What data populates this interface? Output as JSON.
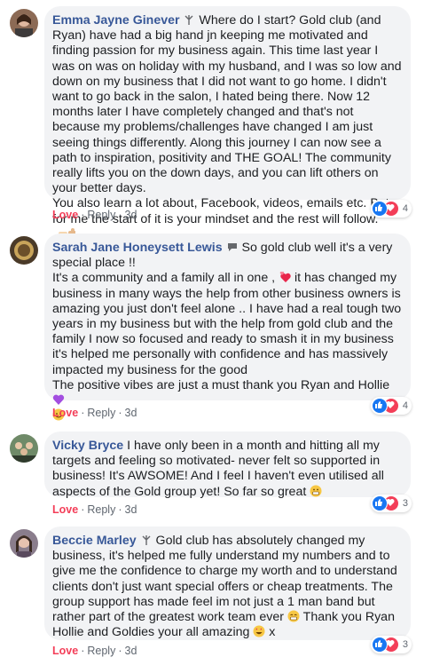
{
  "colors": {
    "name": "#385898",
    "love": "#f33e58",
    "bubble_bg": "#f2f3f5",
    "meta": "#606770",
    "like_blue": "#1877f2"
  },
  "comments": [
    {
      "author": "Emma Jayne Ginever",
      "badge_icon": "rising-star-icon",
      "text": " Where do I start? Gold club (and Ryan) have had a big hand jn keeping me motivated and finding passion for my business again. This time last year I was on was on holiday with my husband, and I was so low and down on my business that I did not want to go home. I didn't want to go back in the salon, I hated being there. Now 12 months later I have completely changed and that's not because my problems/challenges have changed I am just seeing things differently. Along this journey I can now see a path to inspiration, positivity and THE GOAL! The community really lifts you on the down days, and you can lift others on your better days.\nYou also learn a lot about, Facebook, videos, emails etc. But for me the start of it is your mindset and the rest will follow.",
      "trailing_emoji": "thumbs-up-emoji",
      "love_label": "Love",
      "reply_label": "Reply",
      "time": "3d",
      "reaction_count": "4"
    },
    {
      "author": "Sarah Jane Honeysett Lewis",
      "badge_icon": "conversation-starter-icon",
      "text": " So gold club well it's a very special place !!\nIt's a community and a family all in one ,",
      "text2": " it has changed my business in many ways the help from other business owners is amazing you just don't feel alone .. I have had a real tough two years in my business but with the help from gold club and the family I now so focused and ready to smash it in my business it's helped me personally with confidence and has massively impacted my business for the good\nThe positive vibes are just a must thank you Ryan and Hollie",
      "love_label": "Love",
      "reply_label": "Reply",
      "time": "3d",
      "reaction_count": "4"
    },
    {
      "author": "Vicky Bryce",
      "text": " I have only been in a month and hitting all my targets and feeling so motivated- never felt so supported in business! It's AWSOME! And I feel I haven't even utilised all aspects of the Gold group yet! So far so great",
      "love_label": "Love",
      "reply_label": "Reply",
      "time": "3d",
      "reaction_count": "3"
    },
    {
      "author": "Beccie Marley",
      "badge_icon": "rising-star-icon",
      "text": " Gold club has absolutely changed my business, it's helped me fully understand my numbers and to give me the confidence to charge my worth and to understand clients don't just want special offers or cheap treatments. The group support has made feel im not just a 1 man band but rather part of the greatest work team ever",
      "text2": " Thank you Ryan Hollie and Goldies your all amazing",
      "text3": " x",
      "love_label": "Love",
      "reply_label": "Reply",
      "time": "3d",
      "reaction_count": "3"
    }
  ]
}
